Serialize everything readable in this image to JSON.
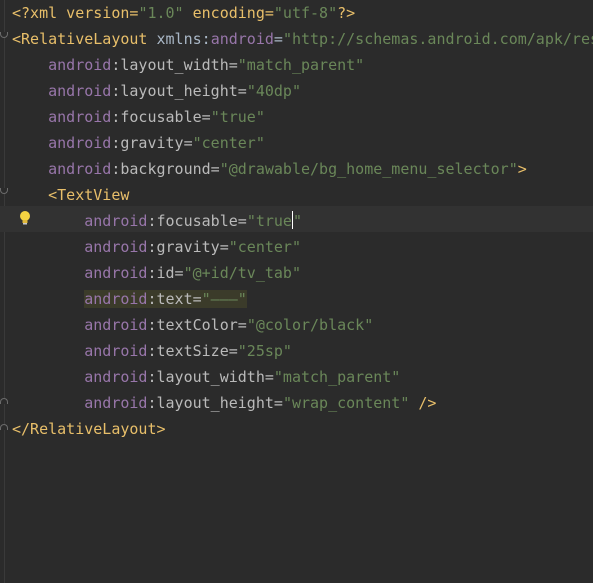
{
  "editor": {
    "lines": [
      {
        "indent": "",
        "parts": [
          {
            "t": "<?xml version=",
            "c": "pi"
          },
          {
            "t": "\"1.0\"",
            "c": "val"
          },
          {
            "t": " encoding=",
            "c": "pi"
          },
          {
            "t": "\"utf-8\"",
            "c": "val"
          },
          {
            "t": "?>",
            "c": "pi"
          }
        ]
      },
      {
        "indent": "",
        "parts": [
          {
            "t": "<RelativeLayout",
            "c": "tag"
          },
          {
            "t": " xmlns:",
            "c": "plain"
          },
          {
            "t": "android",
            "c": "ns"
          },
          {
            "t": "=",
            "c": "plain"
          },
          {
            "t": "\"http://schemas.android.com/apk/res/android\"",
            "c": "val"
          }
        ]
      },
      {
        "indent": "    ",
        "parts": [
          {
            "t": "android",
            "c": "ns"
          },
          {
            "t": ":layout_width=",
            "c": "attr"
          },
          {
            "t": "\"match_parent\"",
            "c": "val"
          }
        ]
      },
      {
        "indent": "    ",
        "parts": [
          {
            "t": "android",
            "c": "ns"
          },
          {
            "t": ":layout_height=",
            "c": "attr"
          },
          {
            "t": "\"40dp\"",
            "c": "val"
          }
        ]
      },
      {
        "indent": "    ",
        "parts": [
          {
            "t": "android",
            "c": "ns"
          },
          {
            "t": ":focusable=",
            "c": "attr"
          },
          {
            "t": "\"true\"",
            "c": "val"
          }
        ]
      },
      {
        "indent": "    ",
        "parts": [
          {
            "t": "android",
            "c": "ns"
          },
          {
            "t": ":gravity=",
            "c": "attr"
          },
          {
            "t": "\"center\"",
            "c": "val"
          }
        ]
      },
      {
        "indent": "    ",
        "parts": [
          {
            "t": "android",
            "c": "ns"
          },
          {
            "t": ":background=",
            "c": "attr"
          },
          {
            "t": "\"@drawable/bg_home_menu_selector\"",
            "c": "val"
          },
          {
            "t": ">",
            "c": "tag"
          }
        ]
      },
      {
        "indent": "    ",
        "parts": [
          {
            "t": "<TextView",
            "c": "tag"
          }
        ]
      },
      {
        "indent": "        ",
        "parts": [
          {
            "t": "android",
            "c": "ns"
          },
          {
            "t": ":focusable=",
            "c": "attr"
          },
          {
            "t": "\"true",
            "c": "val"
          },
          {
            "t": "|caret|",
            "c": "caret"
          },
          {
            "t": "\"",
            "c": "val"
          }
        ]
      },
      {
        "indent": "        ",
        "parts": [
          {
            "t": "android",
            "c": "ns"
          },
          {
            "t": ":gravity=",
            "c": "attr"
          },
          {
            "t": "\"center\"",
            "c": "val"
          }
        ]
      },
      {
        "indent": "        ",
        "parts": [
          {
            "t": "android",
            "c": "ns"
          },
          {
            "t": ":id=",
            "c": "attr"
          },
          {
            "t": "\"@+id/tv_tab\"",
            "c": "val"
          }
        ]
      },
      {
        "indent": "        ",
        "highlight": true,
        "parts": [
          {
            "t": "android",
            "c": "ns"
          },
          {
            "t": ":text=",
            "c": "attr"
          },
          {
            "t": "\"———\"",
            "c": "val"
          }
        ]
      },
      {
        "indent": "        ",
        "parts": [
          {
            "t": "android",
            "c": "ns"
          },
          {
            "t": ":textColor=",
            "c": "attr"
          },
          {
            "t": "\"@color/black\"",
            "c": "val"
          }
        ]
      },
      {
        "indent": "        ",
        "parts": [
          {
            "t": "android",
            "c": "ns"
          },
          {
            "t": ":textSize=",
            "c": "attr"
          },
          {
            "t": "\"25sp\"",
            "c": "val"
          }
        ]
      },
      {
        "indent": "        ",
        "parts": [
          {
            "t": "android",
            "c": "ns"
          },
          {
            "t": ":layout_width=",
            "c": "attr"
          },
          {
            "t": "\"match_parent\"",
            "c": "val"
          }
        ]
      },
      {
        "indent": "        ",
        "parts": [
          {
            "t": "android",
            "c": "ns"
          },
          {
            "t": ":layout_height=",
            "c": "attr"
          },
          {
            "t": "\"wrap_content\"",
            "c": "val"
          },
          {
            "t": " />",
            "c": "tag"
          }
        ]
      },
      {
        "indent": "",
        "parts": [
          {
            "t": "</RelativeLayout>",
            "c": "tag"
          }
        ]
      }
    ],
    "gutter_icon": "lightbulb-icon",
    "colors": {
      "background": "#2b2b2b",
      "tag": "#e8bf6a",
      "namespace": "#9876aa",
      "attribute": "#bababa",
      "value": "#6a8759",
      "caret_row": "#323232",
      "highlight": "#3b3b2a"
    }
  }
}
